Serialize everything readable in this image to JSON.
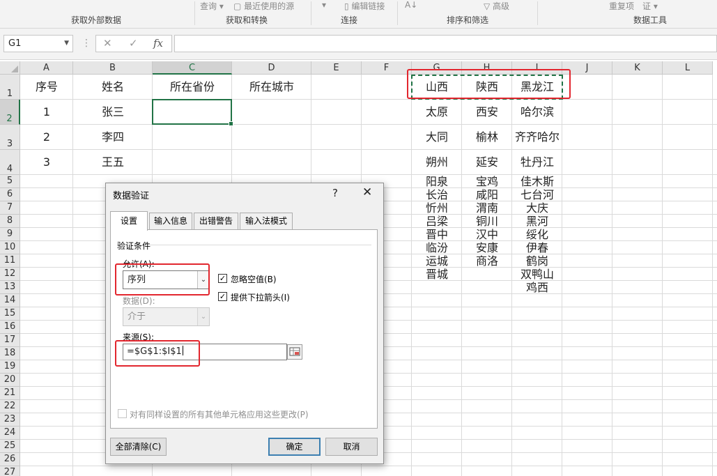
{
  "ribbon": {
    "fragments": {
      "query": "查询 ▾",
      "recent_sources": "最近使用的源",
      "edit_links": "编辑链接",
      "advanced": "高级",
      "remove_duplicates": "重复项",
      "validation": "证 ▾"
    },
    "groups": {
      "get_external": "获取外部数据",
      "get_transform": "获取和转换",
      "connections": "连接",
      "sort_filter": "排序和筛选",
      "data_tools": "数据工具"
    }
  },
  "formula_bar": {
    "name_box": "G1",
    "dots": "⋮",
    "cancel": "✕",
    "enter": "✓",
    "fx": "fx",
    "content": ""
  },
  "sheet": {
    "columns": [
      "A",
      "B",
      "C",
      "D",
      "E",
      "F",
      "G",
      "H",
      "I",
      "J",
      "K",
      "L"
    ],
    "rows": [
      "1",
      "2",
      "3",
      "4",
      "5",
      "6",
      "7",
      "8",
      "9",
      "10",
      "11",
      "12",
      "13",
      "14",
      "15",
      "16",
      "17",
      "18",
      "19",
      "20",
      "21",
      "22",
      "23",
      "24",
      "25",
      "26",
      "27"
    ],
    "cells": {
      "A1": "序号",
      "B1": "姓名",
      "C1": "所在省份",
      "D1": "所在城市",
      "A2": "1",
      "B2": "张三",
      "A3": "2",
      "B3": "李四",
      "A4": "3",
      "B4": "王五",
      "G1": "山西",
      "H1": "陕西",
      "I1": "黑龙江",
      "G2": "太原",
      "H2": "西安",
      "I2": "哈尔滨",
      "G3": "大同",
      "H3": "榆林",
      "I3": "齐齐哈尔",
      "G4": "朔州",
      "H4": "延安",
      "I4": "牡丹江",
      "G5": "阳泉",
      "H5": "宝鸡",
      "I5": "佳木斯",
      "G6": "长治",
      "H6": "咸阳",
      "I6": "七台河",
      "G7": "忻州",
      "H7": "渭南",
      "I7": "大庆",
      "G8": "吕梁",
      "H8": "铜川",
      "I8": "黑河",
      "G9": "晋中",
      "H9": "汉中",
      "I9": "绥化",
      "G10": "临汾",
      "H10": "安康",
      "I10": "伊春",
      "G11": "运城",
      "H11": "商洛",
      "I11": "鹤岗",
      "G12": "晋城",
      "I12": "双鸭山",
      "I13": "鸡西"
    },
    "selected_cell": "C2",
    "copy_range": "G1:I1"
  },
  "dialog": {
    "title": "数据验证",
    "help": "?",
    "close": "✕",
    "tabs": [
      "设置",
      "输入信息",
      "出错警告",
      "输入法模式"
    ],
    "active_tab": 0,
    "section_label": "验证条件",
    "allow_label": "允许(A):",
    "allow_value": "序列",
    "data_label": "数据(D):",
    "data_value": "介于",
    "ignore_blank_label": "忽略空值(B)",
    "ignore_blank_checked": "✓",
    "dropdown_label": "提供下拉箭头(I)",
    "dropdown_checked": "✓",
    "source_label": "来源(S):",
    "source_value": "=$G$1:$I$1",
    "apply_all_label": "对有同样设置的所有其他单元格应用这些更改(P)",
    "clear_all": "全部清除(C)",
    "ok": "确定",
    "cancel": "取消"
  },
  "colors": {
    "excel_green": "#217346",
    "highlight_red": "#e2262e",
    "default_button_border": "#3c7fb1"
  }
}
